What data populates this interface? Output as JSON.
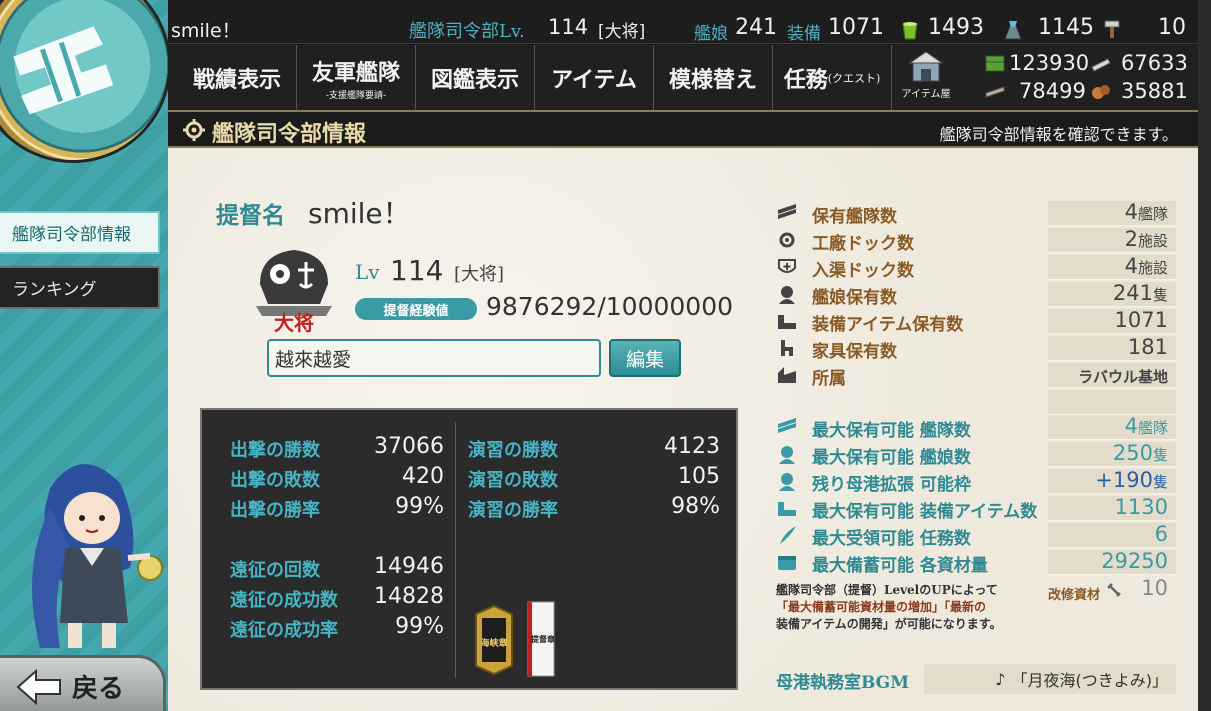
{
  "top_bar": {
    "player_name": "smile！",
    "hq_level_label": "艦隊司令部Lv.",
    "hq_level": "114",
    "hq_rank": "[大将]",
    "ship_label": "艦娘",
    "ship_count": "241",
    "equip_label": "装備",
    "equip_count": "1071",
    "buckets": "1493",
    "burners": "1145",
    "hammers": "10"
  },
  "menu": {
    "battle_record": "戦績表示",
    "friend_fleet": "友軍艦隊",
    "friend_fleet_sub": "-支援艦隊要請-",
    "encyclopedia": "図鑑表示",
    "items": "アイテム",
    "remodel": "模様替え",
    "quest": "任務",
    "quest_sub": "(クエスト)",
    "item_shop": "アイテム屋"
  },
  "resources": {
    "fuel": "123930",
    "ammo": "67633",
    "steel": "78499",
    "bauxite": "35881"
  },
  "section": {
    "title": "艦隊司令部情報",
    "description": "艦隊司令部情報を確認できます。"
  },
  "sidebar": {
    "items": [
      {
        "label": "艦隊司令部情報"
      },
      {
        "label": "ランキング"
      }
    ],
    "back_label": "戻る"
  },
  "profile": {
    "admiral_label": "提督名",
    "admiral_name": "smile！",
    "lv_label": "Lv",
    "level": "114",
    "rank": "[大将]",
    "exp_label": "提督経験値",
    "exp_value": "9876292/10000000",
    "comment": "越來越愛",
    "edit_label": "編集",
    "emblem_text": "大将"
  },
  "battle_stats": {
    "sortie_wins_label": "出撃の勝数",
    "sortie_wins": "37066",
    "sortie_losses_label": "出撃の敗数",
    "sortie_losses": "420",
    "sortie_rate_label": "出撃の勝率",
    "sortie_rate": "99%",
    "exercise_wins_label": "演習の勝数",
    "exercise_wins": "4123",
    "exercise_losses_label": "演習の敗数",
    "exercise_losses": "105",
    "exercise_rate_label": "演習の勝率",
    "exercise_rate": "98%",
    "expedition_count_label": "遠征の回数",
    "expedition_count": "14946",
    "expedition_success_label": "遠征の成功数",
    "expedition_success": "14828",
    "expedition_rate_label": "遠征の成功率",
    "expedition_rate": "99%",
    "medal1_text": "海峡章",
    "medal2_text": "提督章"
  },
  "hq_info": {
    "rows": [
      {
        "label": "保有艦隊数",
        "value": "4",
        "unit": "艦隊",
        "icon": "fleet-icon"
      },
      {
        "label": "工廠ドック数",
        "value": "2",
        "unit": "施設",
        "icon": "gear-icon"
      },
      {
        "label": "入渠ドック数",
        "value": "4",
        "unit": "施設",
        "icon": "repair-icon"
      },
      {
        "label": "艦娘保有数",
        "value": "241",
        "unit": "隻",
        "icon": "shipgirl-icon"
      },
      {
        "label": "装備アイテム保有数",
        "value": "1071",
        "unit": "",
        "icon": "equipment-icon"
      },
      {
        "label": "家具保有数",
        "value": "181",
        "unit": "",
        "icon": "furniture-icon"
      },
      {
        "label": "所属",
        "value": "ラバウル基地",
        "unit": "",
        "icon": "base-icon"
      }
    ],
    "max_rows": [
      {
        "label": "最大保有可能 艦隊数",
        "value": "4",
        "unit": "艦隊",
        "icon": "fleet-icon"
      },
      {
        "label": "最大保有可能 艦娘数",
        "value": "250",
        "unit": "隻",
        "icon": "shipgirl-icon"
      },
      {
        "label": "残り母港拡張 可能枠",
        "value": "+190",
        "unit": "隻",
        "icon": "shipgirl-icon"
      },
      {
        "label": "最大保有可能 装備アイテム数",
        "value": "1130",
        "unit": "",
        "icon": "equipment-icon"
      },
      {
        "label": "最大受領可能 任務数",
        "value": "6",
        "unit": "",
        "icon": "quest-icon"
      },
      {
        "label": "最大備蓄可能 各資材量",
        "value": "29250",
        "unit": "",
        "icon": "storage-icon"
      }
    ],
    "note_line1": "艦隊司令部（提督）LevelのUPによって",
    "note_line2": "「最大備蓄可能資材量の増加」「最新の",
    "note_line3": "装備アイテムの開発」が可能になります。",
    "kaishu_label": "改修資材",
    "kaishu_value": "10",
    "bgm_label": "母港執務室BGM",
    "bgm_note": "♪",
    "bgm_value": "「月夜海(つきよみ)」"
  },
  "colors": {
    "teal": "#2f8a93",
    "brown": "#8a5a26",
    "panel": "#eee9dc",
    "dark": "#1d1d1d"
  }
}
